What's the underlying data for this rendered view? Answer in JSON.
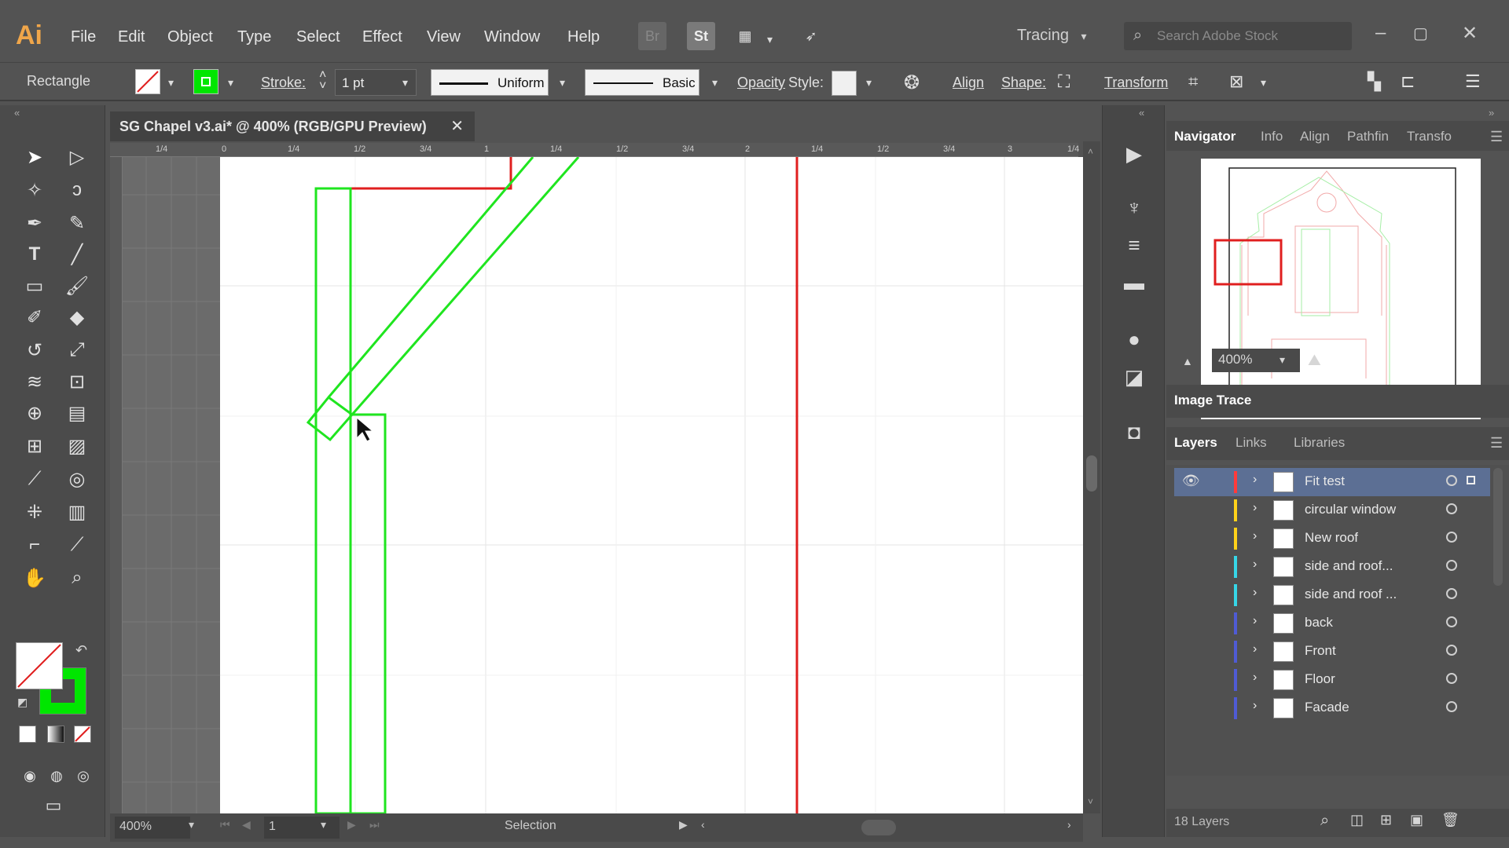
{
  "app": {
    "logo": "Ai",
    "menu": [
      "File",
      "Edit",
      "Object",
      "Type",
      "Select",
      "Effect",
      "View",
      "Window",
      "Help"
    ],
    "bridge_label": "Br",
    "stock_label": "St",
    "workspace": "Tracing",
    "search_placeholder": "Search Adobe Stock"
  },
  "control_bar": {
    "selection_type": "Rectangle",
    "stroke_label": "Stroke:",
    "stroke_weight": "1 pt",
    "profile": "Uniform",
    "brush": "Basic",
    "opacity_label": "Opacity",
    "style_label": "Style:",
    "align_label": "Align",
    "shape_label": "Shape:",
    "transform_label": "Transform",
    "fill_color": "#ff0000",
    "stroke_color": "#00e600"
  },
  "document": {
    "tab_title": "SG Chapel v3.ai* @ 400% (RGB/GPU Preview)",
    "zoom": "400%",
    "artboard_number": "1",
    "status_tool": "Selection",
    "ruler_marks": [
      "1/4",
      "0",
      "1/4",
      "1/2",
      "3/4",
      "1",
      "1/4",
      "1/2",
      "3/4",
      "2",
      "1/4",
      "1/2",
      "3/4",
      "3",
      "1/4"
    ]
  },
  "navigator": {
    "tabs": [
      "Navigator",
      "Info",
      "Align",
      "Pathfin",
      "Transfo"
    ],
    "zoom": "400%"
  },
  "image_trace": {
    "title": "Image Trace"
  },
  "layers_panel": {
    "tabs": [
      "Layers",
      "Links",
      "Libraries"
    ],
    "layers": [
      {
        "name": "Fit test",
        "color": "#ff3a3a"
      },
      {
        "name": "circular window",
        "color": "#ffd21a"
      },
      {
        "name": "New roof",
        "color": "#ffd21a"
      },
      {
        "name": "side and roof...",
        "color": "#36d6e7"
      },
      {
        "name": "side and roof ...",
        "color": "#36d6e7"
      },
      {
        "name": "back",
        "color": "#4f5bd5"
      },
      {
        "name": "Front",
        "color": "#4f5bd5"
      },
      {
        "name": "Floor",
        "color": "#4f5bd5"
      },
      {
        "name": "Facade",
        "color": "#4f5bd5"
      }
    ],
    "count": "18 Layers"
  },
  "colors": {
    "accent_green": "#00e600",
    "accent_red": "#e01f1f"
  }
}
